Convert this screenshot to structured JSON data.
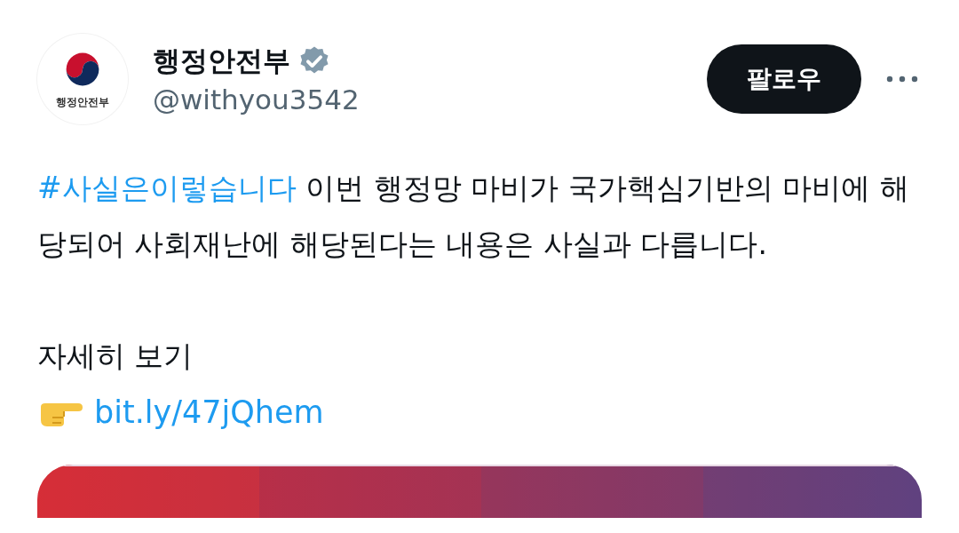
{
  "account": {
    "name": "행정안전부",
    "handle": "@withyou3542",
    "verified": true,
    "logo_text": "행정안전부"
  },
  "follow_button": {
    "label": "팔로우"
  },
  "post": {
    "hashtag": "#사실은이렇습니다",
    "text": " 이번 행정망 마비가 국가핵심기반의 마비에 해당되어 사회재난에 해당된다는 내용은 사실과 다릅니다.",
    "more_label": "자세히 보기",
    "link": "bit.ly/47jQhem"
  }
}
